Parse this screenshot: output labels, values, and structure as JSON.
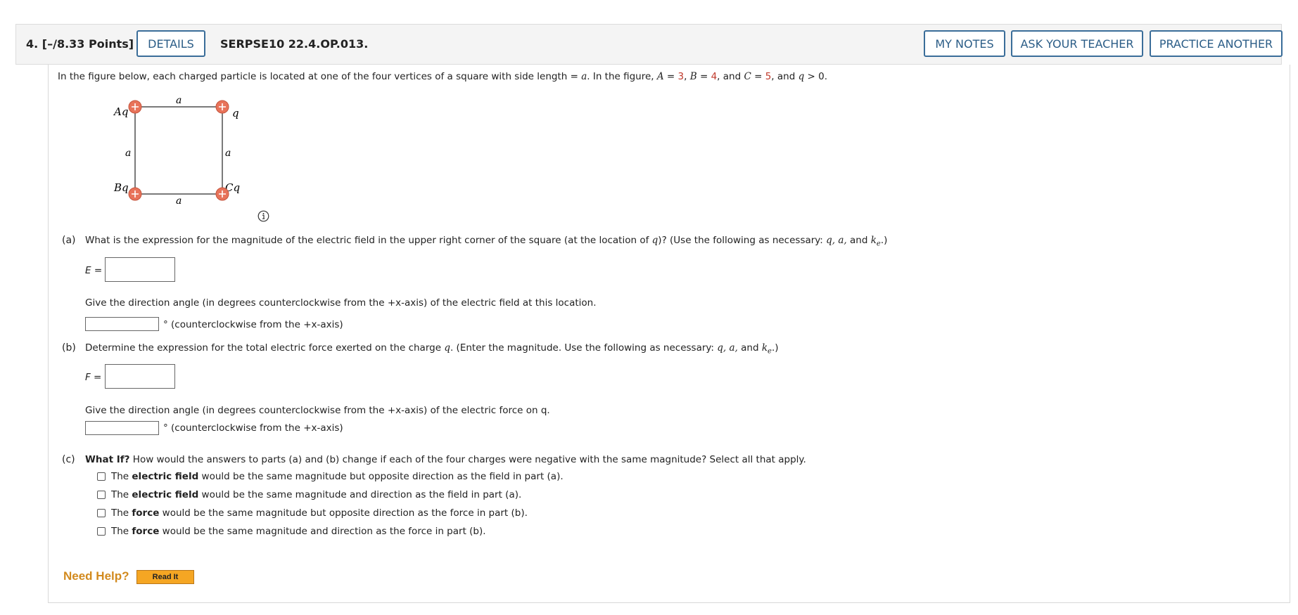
{
  "header": {
    "question_number": "4.",
    "points": "[–/8.33 Points]",
    "details_label": "DETAILS",
    "problem_code": "SERPSE10 22.4.OP.013.",
    "my_notes_label": "MY NOTES",
    "ask_teacher_label": "ASK YOUR TEACHER",
    "practice_label": "PRACTICE ANOTHER"
  },
  "intro": {
    "prefix": "In the figure below, each charged particle is located at one of the four vertices of a square with side length = ",
    "a": "a",
    "mid1": ". In the figure, ",
    "A": "A",
    "eq": " = ",
    "A_val": "3",
    "comma1": ", ",
    "B": "B",
    "B_val": "4",
    "and1": ", and ",
    "C": "C",
    "C_val": "5",
    "and2": ", and ",
    "q": "q",
    "gt": " > 0."
  },
  "figure": {
    "label_top": "a",
    "label_bottom": "a",
    "label_left": "a",
    "label_right": "a",
    "charge_tl": "Aq",
    "charge_tr": "q",
    "charge_bl": "Bq",
    "charge_br": "Cq",
    "charge_color": "#e8735a"
  },
  "part_a": {
    "tag": "(a)",
    "question_prefix": "What is the expression for the magnitude of the electric field in the upper right corner of the square (at the location of ",
    "question_q": "q",
    "question_mid": ")? (Use the following as necessary: ",
    "vars": "q, a,",
    "and": " and ",
    "ke": "k",
    "ke_sub": "e",
    "end": ".)",
    "answer_label": "E =",
    "direction_prompt": "Give the direction angle (in degrees counterclockwise from the +x-axis) of the electric field at this location.",
    "direction_suffix": "° (counterclockwise from the +x-axis)"
  },
  "part_b": {
    "tag": "(b)",
    "question_prefix": "Determine the expression for the total electric force exerted on the charge ",
    "question_q": "q",
    "question_mid": ". (Enter the magnitude. Use the following as necessary: ",
    "vars": "q, a,",
    "and": " and ",
    "ke": "k",
    "ke_sub": "e",
    "end": ".)",
    "answer_label": "F =",
    "direction_prompt": "Give the direction angle (in degrees counterclockwise from the +x-axis) of the electric force on q.",
    "direction_suffix": "° (counterclockwise from the +x-axis)"
  },
  "part_c": {
    "tag": "(c)",
    "what_if": "What If?",
    "question": " How would the answers to parts (a) and (b) change if each of the four charges were negative with the same magnitude? Select all that apply.",
    "options": [
      {
        "pre": "The ",
        "bold": "electric field",
        "post": " would be the same magnitude but opposite direction as the field in part (a)."
      },
      {
        "pre": "The ",
        "bold": "electric field",
        "post": " would be the same magnitude and direction as the field in part (a)."
      },
      {
        "pre": "The ",
        "bold": "force",
        "post": " would be the same magnitude but opposite direction as the force in part (b)."
      },
      {
        "pre": "The ",
        "bold": "force",
        "post": " would be the same magnitude and direction as the force in part (b)."
      }
    ]
  },
  "help": {
    "need_help": "Need Help?",
    "read_it": "Read It"
  },
  "colors": {
    "accent": "#2b5d87",
    "highlight_red": "#c0392b",
    "help_orange": "#d28a1e",
    "read_it_bg": "#f5a623"
  }
}
